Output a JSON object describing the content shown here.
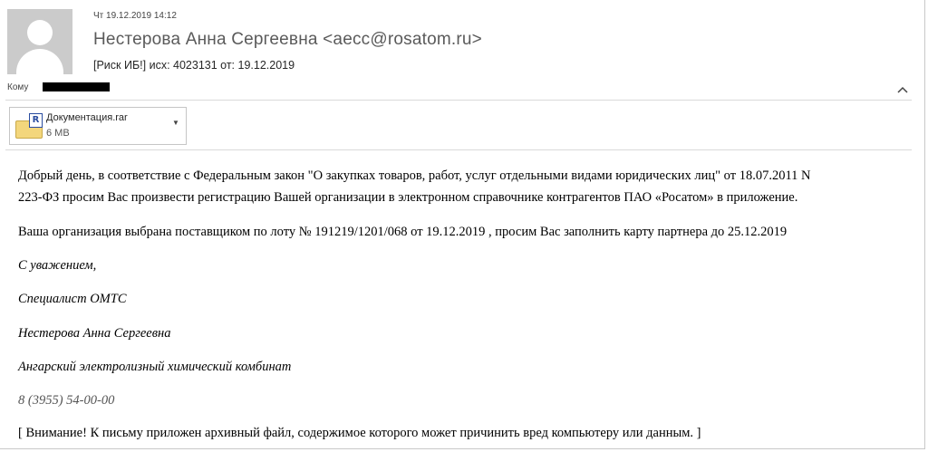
{
  "header": {
    "date": "Чт 19.12.2019 14:12",
    "sender": "Нестерова Анна Сергеевна <aecc@rosatom.ru>",
    "subject": "[Риск ИБ!] исх: 4023131 от: 19.12.2019",
    "to_label": "Кому"
  },
  "attachment": {
    "name": "Документация.rar",
    "size": "6 MB",
    "icon": "winrar-archive-icon"
  },
  "body": {
    "p1_line1": "Добрый день, в соответствие с Федеральным закон \"О закупках товаров, работ, услуг отдельными видами юридических лиц\" от 18.07.2011 N",
    "p1_line2": "223-ФЗ просим Вас произвести регистрацию Вашей организации в электронном справочнике контрагентов ПАО «Росатом» в приложение.",
    "p2": "Ваша организация выбрана поставщиком по лоту № 191219/1201/068 от 19.12.2019 , просим Вас заполнить карту партнера до 25.12.2019",
    "signature": {
      "regards": "С уважением,",
      "position": "Специалист ОМТС",
      "name": "Нестерова Анна Сергеевна",
      "company": "Ангарский электролизный химический комбинат",
      "phone": "8 (3955) 54-00-00"
    },
    "warning": "[ Внимание! К письму приложен архивный файл, содержимое которого может причинить вред компьютеру или данным. ]"
  }
}
